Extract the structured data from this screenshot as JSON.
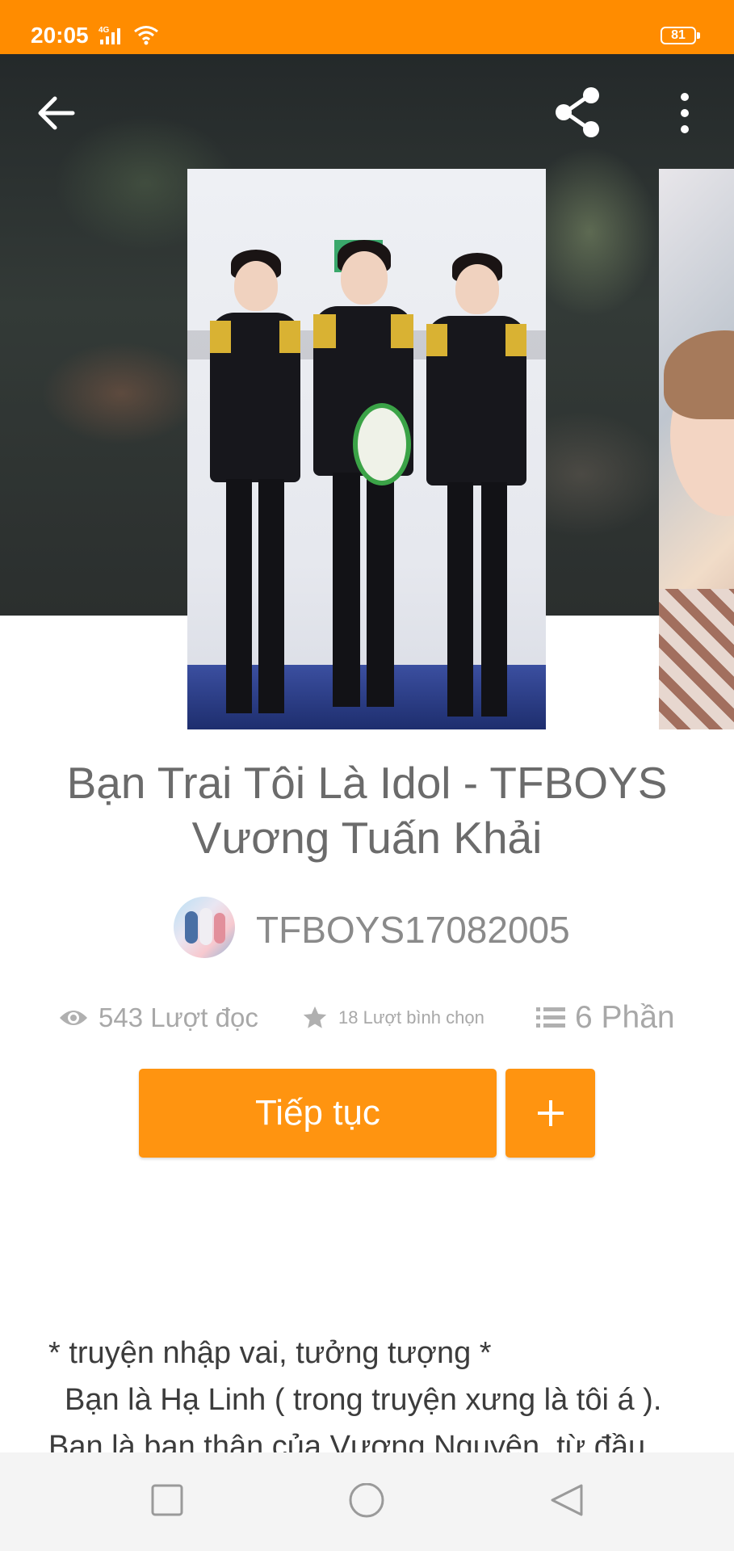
{
  "status_bar": {
    "time": "20:05",
    "network": "4G",
    "battery": "81"
  },
  "toolbar": {
    "back_icon": "arrow-left-icon",
    "share_icon": "share-icon",
    "more_icon": "more-vertical-icon"
  },
  "story": {
    "title_line1": "Bạn Trai Tôi Là Idol - TFBOYS",
    "title_line2": "Vương Tuấn Khải",
    "author": "TFBOYS17082005",
    "stats": {
      "reads": "543 Lượt đọc",
      "votes": "18 Lượt bình chọn",
      "parts": "6 Phần"
    },
    "continue_label": "Tiếp tục",
    "add_label": "+",
    "description": [
      "* truyện nhập vai, tưởng tượng *",
      "Bạn là Hạ Linh ( trong truyện xưng là tôi á ).",
      "Bạn là bạn thân của Vương Nguyên, từ đầu"
    ]
  },
  "nav_bar": {
    "recents_icon": "square-icon",
    "home_icon": "circle-icon",
    "back_icon": "triangle-back-icon"
  },
  "colors": {
    "accent": "#ff9410",
    "status_bar": "#ff8c00"
  }
}
